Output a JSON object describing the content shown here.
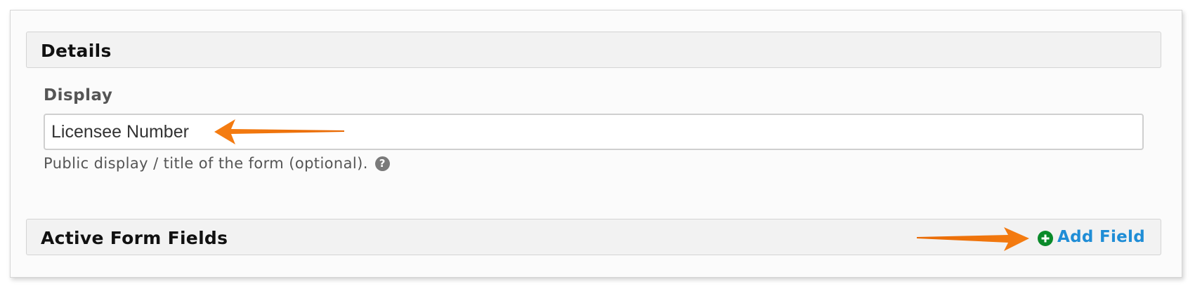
{
  "details": {
    "title": "Details"
  },
  "display_field": {
    "label": "Display",
    "value": "Licensee Number",
    "help_text": "Public display / title of the form (optional).",
    "help_icon": "question-circle-icon"
  },
  "active_fields": {
    "title": "Active Form Fields",
    "add_label": "Add Field",
    "add_icon": "plus-circle-icon"
  },
  "annotations": {
    "arrow_color": "#f07a10"
  },
  "colors": {
    "link": "#1f8dd6",
    "add_icon": "#0a8a2a",
    "header_bg": "#f2f2f2"
  }
}
